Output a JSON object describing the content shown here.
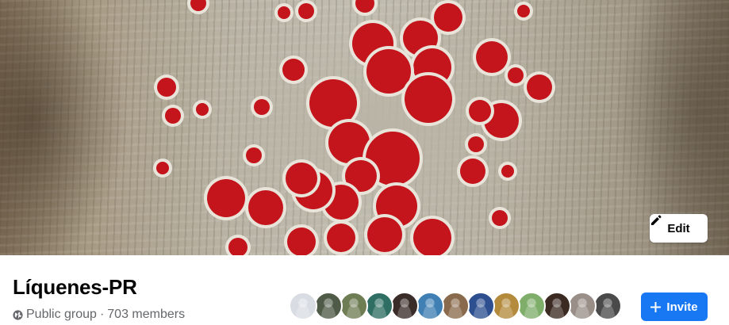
{
  "cover": {
    "image": "lichen-cover-photo",
    "edit_label": "Edit"
  },
  "group": {
    "name": "Líquenes-PR",
    "privacy": "Public group",
    "separator": "·",
    "members": "703 members"
  },
  "member_avatars": [
    {
      "name": "member-avatar-1",
      "color": "#d9dde3"
    },
    {
      "name": "member-avatar-2",
      "color": "#4f5a47"
    },
    {
      "name": "member-avatar-3",
      "color": "#6f7d55"
    },
    {
      "name": "member-avatar-4",
      "color": "#2f6f63"
    },
    {
      "name": "member-avatar-5",
      "color": "#3a2c28"
    },
    {
      "name": "member-avatar-6",
      "color": "#3f7fb4"
    },
    {
      "name": "member-avatar-7",
      "color": "#8a6a4c"
    },
    {
      "name": "member-avatar-8",
      "color": "#2d4f8f"
    },
    {
      "name": "member-avatar-9",
      "color": "#b48a3c"
    },
    {
      "name": "member-avatar-10",
      "color": "#7fae6a"
    },
    {
      "name": "member-avatar-11",
      "color": "#3b2a22"
    },
    {
      "name": "member-avatar-12",
      "color": "#9a8f88"
    },
    {
      "name": "member-avatar-13",
      "color": "#4a4a4a"
    }
  ],
  "actions": {
    "invite_label": "Invite"
  },
  "colors": {
    "primary": "#1877f2",
    "text": "#050505",
    "secondary_text": "#65676b",
    "lichen_red": "#c4141c"
  }
}
